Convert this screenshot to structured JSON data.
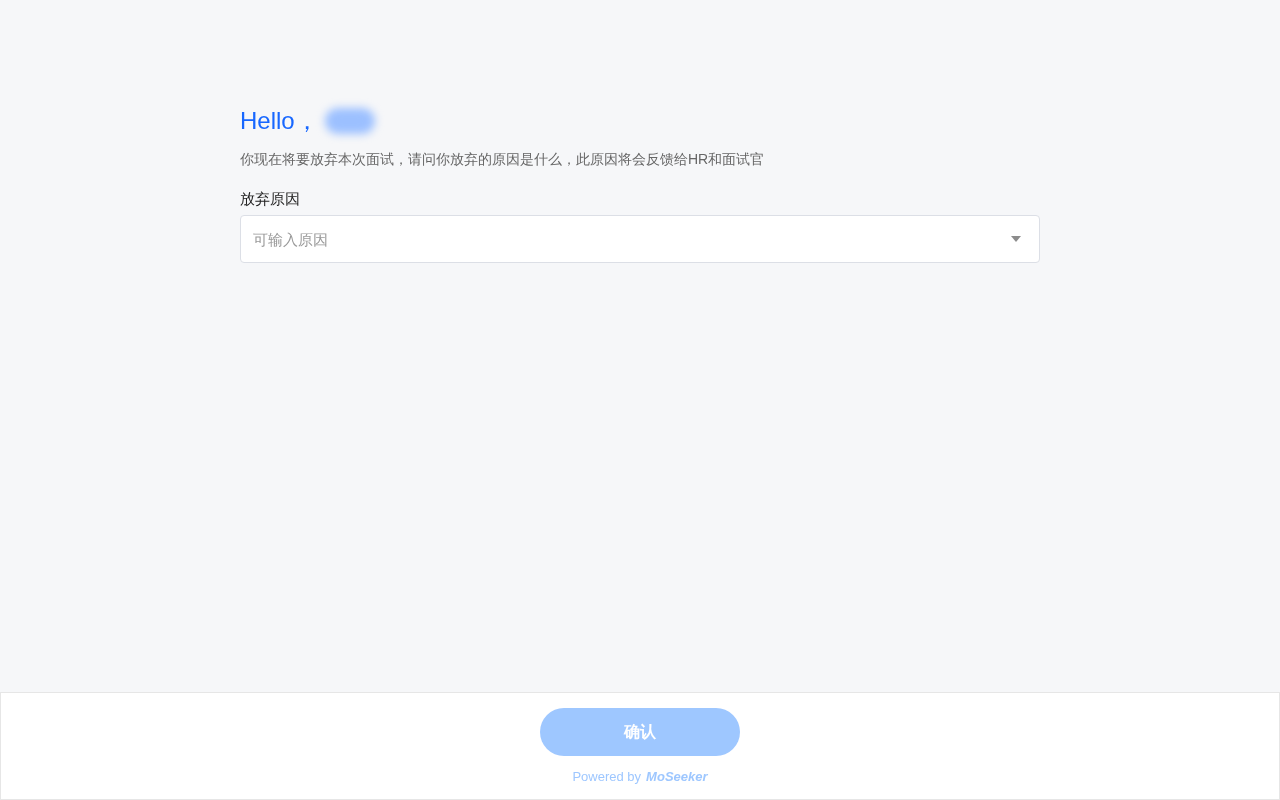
{
  "greeting": "Hello，",
  "description": "你现在将要放弃本次面试，请问你放弃的原因是什么，此原因将会反馈给HR和面试官",
  "reason_field": {
    "label": "放弃原因",
    "placeholder": "可输入原因"
  },
  "footer": {
    "confirm_button": {
      "label": "确认",
      "disabled": true
    },
    "powered_by": "Powered by",
    "brand": "MoSeeker"
  }
}
